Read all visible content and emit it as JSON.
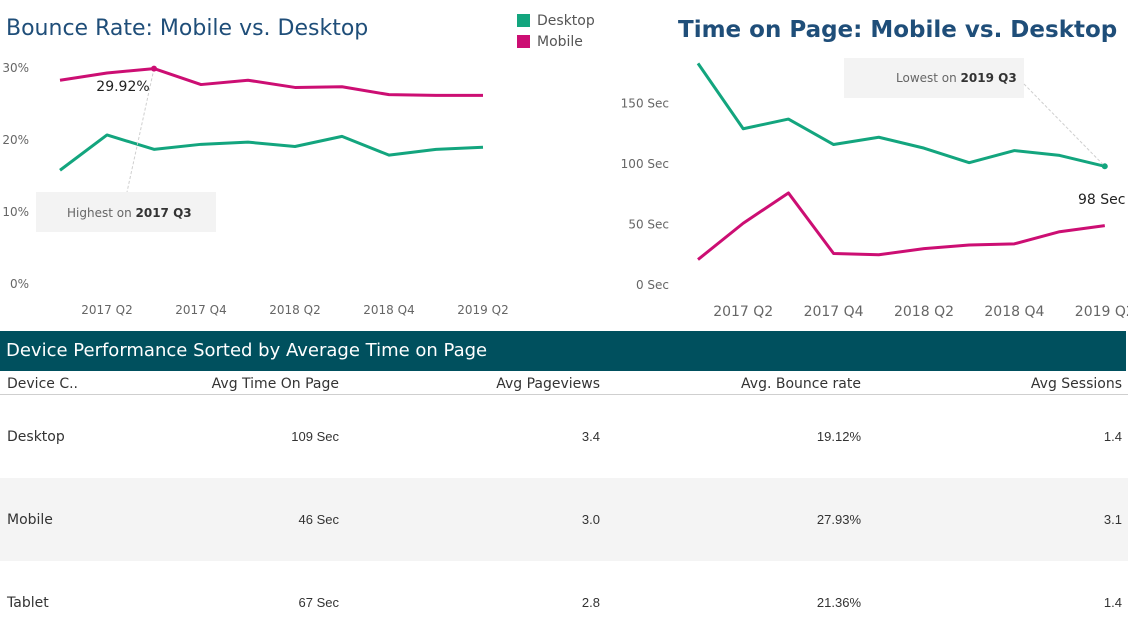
{
  "bounce_chart": {
    "title": "Bounce Rate: Mobile vs. Desktop",
    "callout_text": "Highest on ",
    "callout_bold": "2017 Q3",
    "peak_label": "29.92%"
  },
  "legend": {
    "items": [
      {
        "label": "Desktop",
        "color": "#13a57e"
      },
      {
        "label": "Mobile",
        "color": "#cc0e73"
      }
    ]
  },
  "time_chart": {
    "title": "Time on Page: Mobile vs. Desktop",
    "callout_text": "Lowest on ",
    "callout_bold": "2019 Q3",
    "end_label": "98 Sec"
  },
  "table": {
    "title": "Device Performance Sorted by Average Time on Page",
    "columns": [
      "Device C..",
      "Avg Time On Page",
      "Avg Pageviews",
      "Avg. Bounce rate",
      "Avg Sessions"
    ],
    "rows": [
      [
        "Desktop",
        "109 Sec",
        "3.4",
        "19.12%",
        "1.4"
      ],
      [
        "Mobile",
        "46 Sec",
        "3.0",
        "27.93%",
        "3.1"
      ],
      [
        "Tablet",
        "67 Sec",
        "2.8",
        "21.36%",
        "1.4"
      ]
    ]
  },
  "chart_data": [
    {
      "type": "line",
      "title": "Bounce Rate: Mobile vs. Desktop",
      "x": [
        "2017 Q1",
        "2017 Q2",
        "2017 Q3",
        "2017 Q4",
        "2018 Q1",
        "2018 Q2",
        "2018 Q3",
        "2018 Q4",
        "2019 Q1",
        "2019 Q2",
        "2019 Q3"
      ],
      "x_tick_labels": [
        "2017 Q2",
        "2017 Q4",
        "2018 Q2",
        "2018 Q4",
        "2019 Q2"
      ],
      "y_tick_labels": [
        "0%",
        "10%",
        "20%",
        "30%"
      ],
      "ylim": [
        0,
        30
      ],
      "series": [
        {
          "name": "Desktop",
          "color": "#13a57e",
          "values": [
            15.8,
            20.7,
            18.7,
            19.4,
            19.7,
            19.1,
            20.5,
            17.9,
            18.7,
            19.0
          ]
        },
        {
          "name": "Mobile",
          "color": "#cc0e73",
          "values": [
            28.3,
            29.3,
            29.92,
            27.7,
            28.3,
            27.3,
            27.4,
            26.3,
            26.2,
            26.2
          ]
        }
      ],
      "annotations": [
        "29.92%",
        "Highest on 2017 Q3"
      ],
      "grid": false,
      "legend": "top-right"
    },
    {
      "type": "line",
      "title": "Time on Page: Mobile vs. Desktop",
      "x": [
        "2017 Q1",
        "2017 Q2",
        "2017 Q3",
        "2017 Q4",
        "2018 Q1",
        "2018 Q2",
        "2018 Q3",
        "2018 Q4",
        "2019 Q1",
        "2019 Q2",
        "2019 Q3"
      ],
      "x_tick_labels": [
        "2017 Q2",
        "2017 Q4",
        "2018 Q2",
        "2018 Q4",
        "2019 Q2"
      ],
      "y_tick_labels": [
        "0 Sec",
        "50 Sec",
        "100 Sec",
        "150 Sec"
      ],
      "ylim": [
        0,
        180
      ],
      "series": [
        {
          "name": "Desktop",
          "color": "#13a57e",
          "values": [
            183,
            129,
            137,
            116,
            122,
            113,
            101,
            111,
            107,
            98
          ]
        },
        {
          "name": "Mobile",
          "color": "#cc0e73",
          "values": [
            21,
            51,
            76,
            26,
            25,
            30,
            33,
            34,
            44,
            49
          ]
        }
      ],
      "annotations": [
        "98 Sec",
        "Lowest on 2019 Q3"
      ],
      "grid": false
    }
  ]
}
